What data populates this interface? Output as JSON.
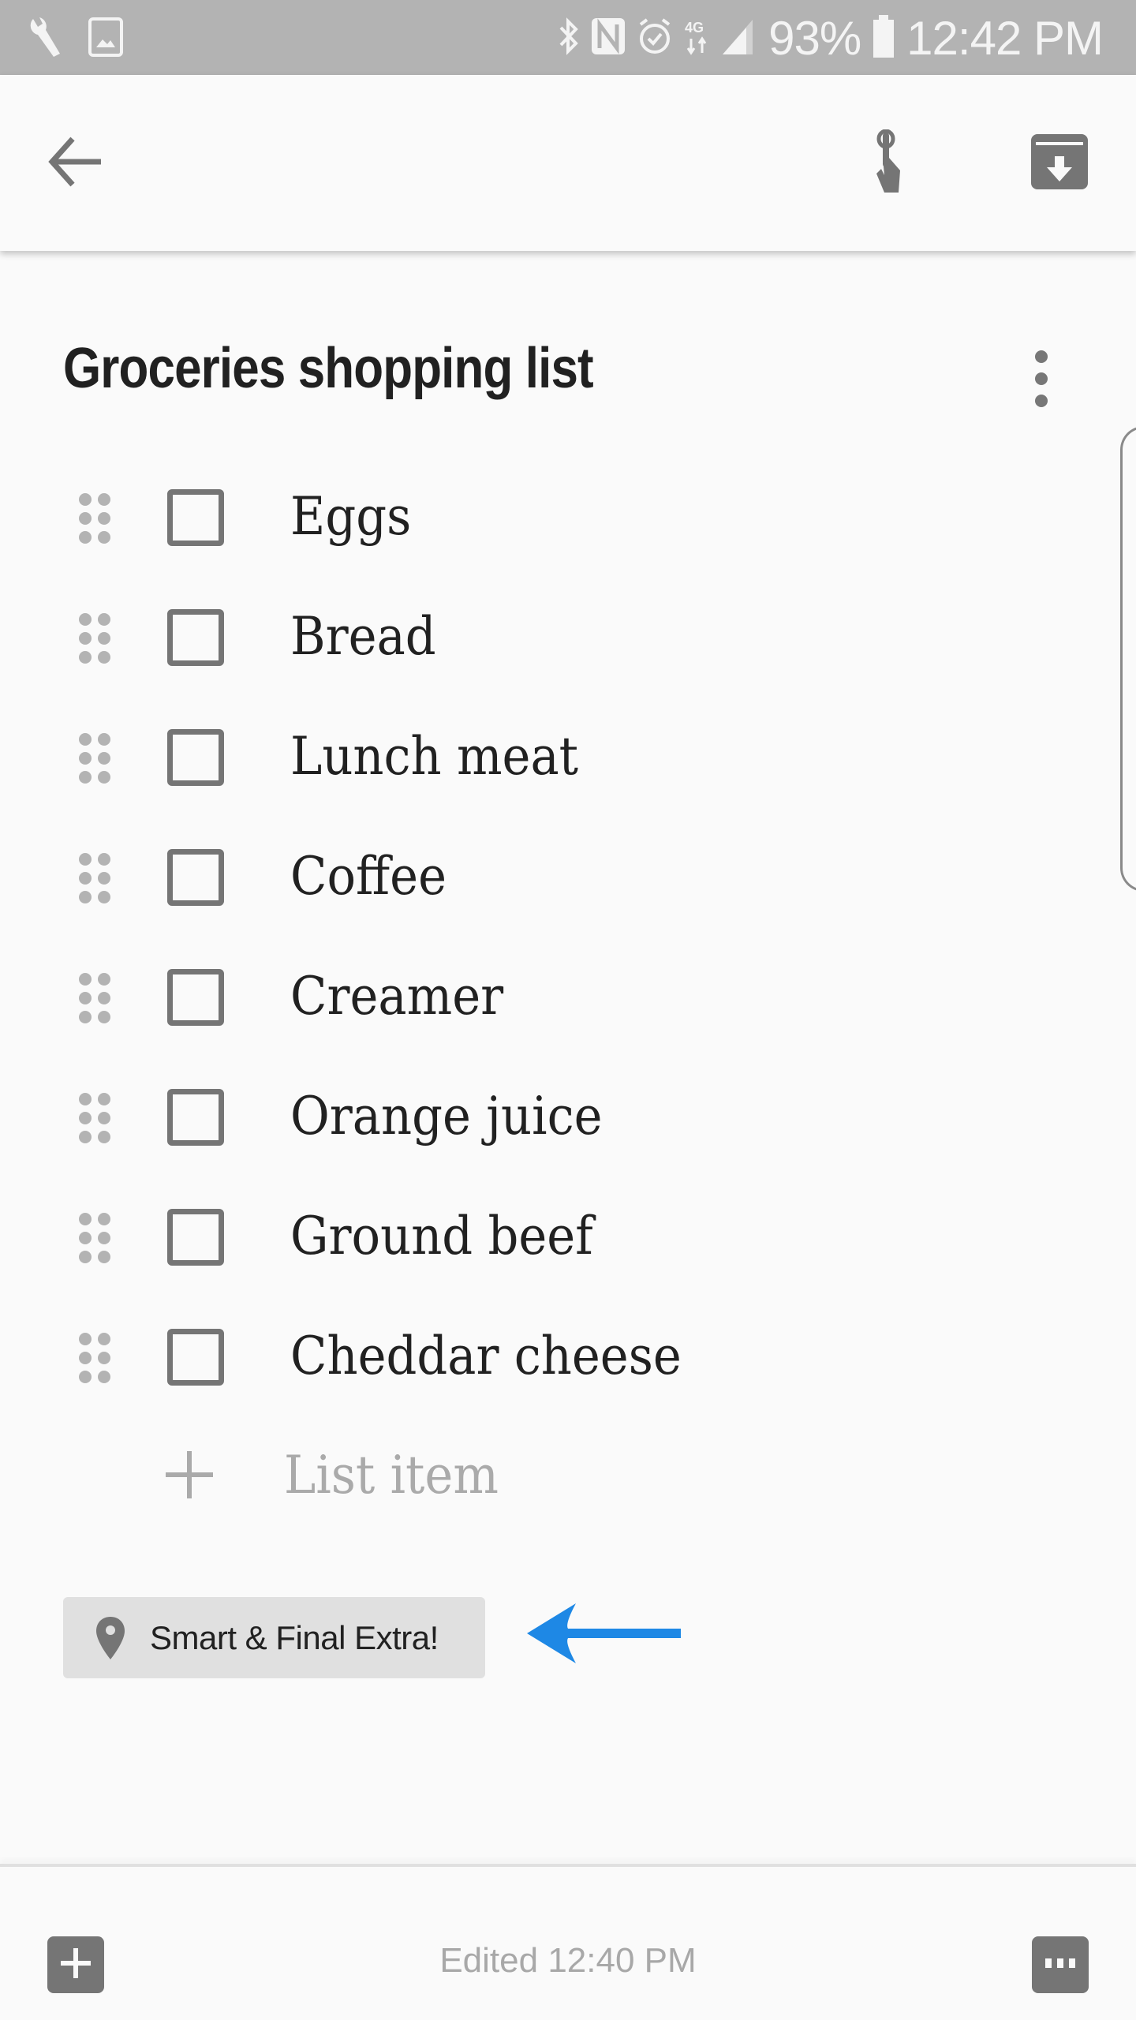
{
  "status_bar": {
    "left_icons": [
      "wrench-icon",
      "image-icon"
    ],
    "right_icons": [
      "bluetooth-icon",
      "nfc-icon",
      "alarm-icon",
      "4g-data-icon",
      "signal-icon"
    ],
    "battery_percent": "93%",
    "time": "12:42 PM"
  },
  "toolbar": {
    "back_icon": "arrow-back-icon",
    "pin_icon": "touch-pin-icon",
    "archive_icon": "archive-icon"
  },
  "note": {
    "title": "Groceries shopping list",
    "items": [
      {
        "label": "Eggs",
        "checked": false
      },
      {
        "label": "Bread",
        "checked": false
      },
      {
        "label": "Lunch meat",
        "checked": false
      },
      {
        "label": "Coffee",
        "checked": false
      },
      {
        "label": "Creamer",
        "checked": false
      },
      {
        "label": "Orange juice",
        "checked": false
      },
      {
        "label": "Ground beef",
        "checked": false
      },
      {
        "label": "Cheddar cheese",
        "checked": false
      }
    ],
    "add_item_placeholder": "List item",
    "location_chip": "Smart & Final Extra!"
  },
  "annotation": {
    "arrow_color": "#1e88e5"
  },
  "bottom_bar": {
    "edited": "Edited 12:40 PM"
  }
}
